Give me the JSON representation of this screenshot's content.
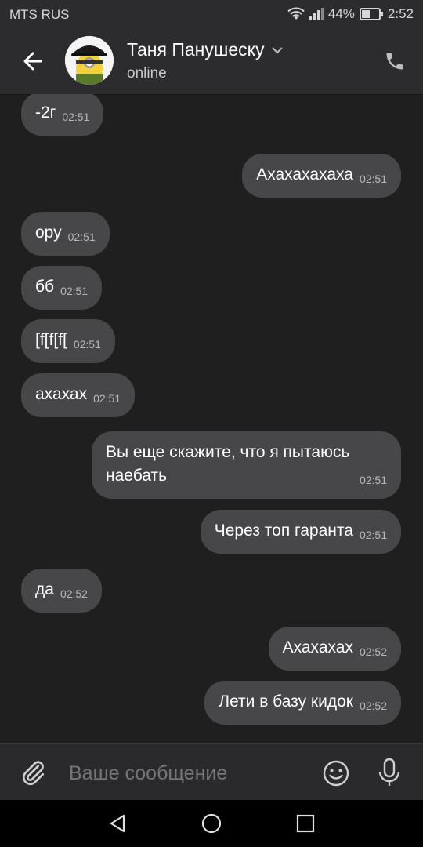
{
  "status": {
    "carrier": "MTS RUS",
    "battery": "44%",
    "time": "2:52"
  },
  "header": {
    "name": "Таня Панушеску",
    "status": "online"
  },
  "messages": [
    {
      "dir": "in",
      "text": "-2г",
      "time": "02:51"
    },
    {
      "dir": "out",
      "text": "Ахахахахаха",
      "time": "02:51"
    },
    {
      "dir": "in",
      "text": "ору",
      "time": "02:51"
    },
    {
      "dir": "in",
      "text": "бб",
      "time": "02:51"
    },
    {
      "dir": "in",
      "text": "[f[f[f[",
      "time": "02:51"
    },
    {
      "dir": "in",
      "text": "ахахах",
      "time": "02:51"
    },
    {
      "dir": "out",
      "text": "Вы еще скажите, что я пытаюсь наебать",
      "time": "02:51"
    },
    {
      "dir": "out",
      "text": "Через топ гаранта",
      "time": "02:51"
    },
    {
      "dir": "in",
      "text": "да",
      "time": "02:52"
    },
    {
      "dir": "out",
      "text": "Ахахахах",
      "time": "02:52"
    },
    {
      "dir": "out",
      "text": "Лети в базу кидок",
      "time": "02:52"
    }
  ],
  "composer": {
    "placeholder": "Ваше сообщение"
  },
  "icons": {
    "back": "arrow-left-icon",
    "call": "phone-icon",
    "attach": "paperclip-icon",
    "emoji": "smiley-icon",
    "mic": "microphone-icon"
  }
}
